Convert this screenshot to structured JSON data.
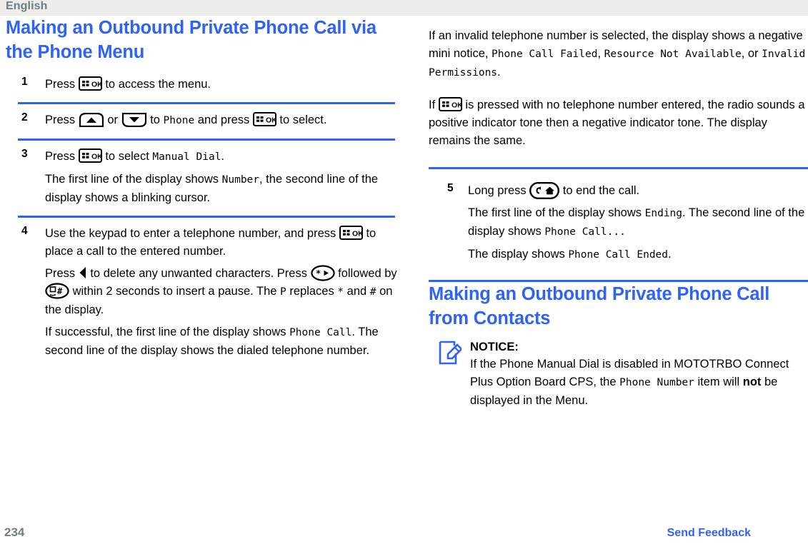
{
  "header": {
    "language": "English",
    "band_color": "#ececeb",
    "text_color": "#6e7f83"
  },
  "accent_color": "#2f63f5",
  "left_column": {
    "heading": "Making an Outbound Private Phone Call via the Phone Menu",
    "steps": [
      {
        "number": "1",
        "parts": [
          {
            "t": "text",
            "v": "Press "
          },
          {
            "t": "icon",
            "v": "ok-key-icon"
          },
          {
            "t": "text",
            "v": " to access the menu."
          }
        ]
      },
      {
        "number": "2",
        "parts": [
          {
            "t": "text",
            "v": "Press "
          },
          {
            "t": "icon",
            "v": "up-key-icon"
          },
          {
            "t": "text",
            "v": " or "
          },
          {
            "t": "icon",
            "v": "down-key-icon"
          },
          {
            "t": "text",
            "v": " to "
          },
          {
            "t": "mono",
            "v": "Phone"
          },
          {
            "t": "text",
            "v": " and press "
          },
          {
            "t": "icon",
            "v": "ok-key-icon"
          },
          {
            "t": "text",
            "v": " to select."
          }
        ]
      },
      {
        "number": "3",
        "parts": [
          {
            "t": "text",
            "v": "Press "
          },
          {
            "t": "icon",
            "v": "ok-key-icon"
          },
          {
            "t": "text",
            "v": " to select "
          },
          {
            "t": "mono",
            "v": "Manual Dial"
          },
          {
            "t": "text",
            "v": "."
          }
        ],
        "extra": [
          [
            {
              "t": "text",
              "v": "The first line of the display shows "
            },
            {
              "t": "mono",
              "v": "Number"
            },
            {
              "t": "text",
              "v": ", the second line of the display shows a blinking cursor."
            }
          ]
        ]
      },
      {
        "number": "4",
        "parts": [
          {
            "t": "text",
            "v": "Use the keypad to enter a telephone number, and press "
          },
          {
            "t": "icon",
            "v": "ok-key-icon"
          },
          {
            "t": "text",
            "v": " to place a call to the entered number."
          }
        ],
        "extra": [
          [
            {
              "t": "text",
              "v": "Press "
            },
            {
              "t": "icon",
              "v": "left-triangle-icon"
            },
            {
              "t": "text",
              "v": " to delete any unwanted characters. Press "
            },
            {
              "t": "icon",
              "v": "star-key-icon"
            },
            {
              "t": "text",
              "v": " followed by "
            },
            {
              "t": "icon",
              "v": "hash-key-icon"
            },
            {
              "t": "text",
              "v": " within 2 seconds to insert a pause. The "
            },
            {
              "t": "mono",
              "v": "P"
            },
            {
              "t": "text",
              "v": " replaces "
            },
            {
              "t": "mono",
              "v": "*"
            },
            {
              "t": "text",
              "v": " and "
            },
            {
              "t": "mono",
              "v": "#"
            },
            {
              "t": "text",
              "v": " on the display."
            }
          ],
          [
            {
              "t": "text",
              "v": "If successful, the first line of the display shows "
            },
            {
              "t": "mono",
              "v": "Phone Call"
            },
            {
              "t": "text",
              "v": ". The second line of the display shows the dialed telephone number."
            }
          ]
        ]
      }
    ]
  },
  "right_column": {
    "intro_paragraphs": [
      [
        {
          "t": "text",
          "v": "If an invalid telephone number is selected, the display shows a negative mini notice, "
        },
        {
          "t": "mono",
          "v": "Phone Call Failed"
        },
        {
          "t": "text",
          "v": ", "
        },
        {
          "t": "mono",
          "v": "Resource Not Available"
        },
        {
          "t": "text",
          "v": ", or "
        },
        {
          "t": "mono",
          "v": "Invalid Permissions"
        },
        {
          "t": "text",
          "v": "."
        }
      ],
      [
        {
          "t": "text",
          "v": "If "
        },
        {
          "t": "icon",
          "v": "ok-key-icon"
        },
        {
          "t": "text",
          "v": " is pressed with no telephone number entered, the radio sounds a positive indicator tone then a negative indicator tone. The display remains the same."
        }
      ]
    ],
    "step": {
      "number": "5",
      "parts": [
        {
          "t": "text",
          "v": "Long press "
        },
        {
          "t": "icon",
          "v": "back-home-key-icon"
        },
        {
          "t": "text",
          "v": " to end the call."
        }
      ],
      "extra": [
        [
          {
            "t": "text",
            "v": "The first line of the display shows "
          },
          {
            "t": "mono",
            "v": "Ending"
          },
          {
            "t": "text",
            "v": ". The second line of the display shows "
          },
          {
            "t": "mono",
            "v": "Phone Call..."
          },
          {
            "t": "text",
            "v": ""
          }
        ],
        [
          {
            "t": "text",
            "v": "The display shows "
          },
          {
            "t": "mono",
            "v": "Phone Call Ended"
          },
          {
            "t": "text",
            "v": "."
          }
        ]
      ]
    },
    "heading": "Making an Outbound Private Phone Call from Contacts",
    "notice": {
      "icon": "notice-pencil-icon",
      "title": "NOTICE:",
      "parts": [
        {
          "t": "text",
          "v": "If the Phone Manual Dial is disabled in MOTOTRBO Connect Plus Option Board CPS, the "
        },
        {
          "t": "mono",
          "v": "Phone Number"
        },
        {
          "t": "text",
          "v": " item will "
        },
        {
          "t": "bold",
          "v": "not"
        },
        {
          "t": "text",
          "v": " be displayed in the Menu."
        }
      ]
    }
  },
  "footer": {
    "page_number": "234",
    "send_feedback_label": "Send Feedback"
  }
}
